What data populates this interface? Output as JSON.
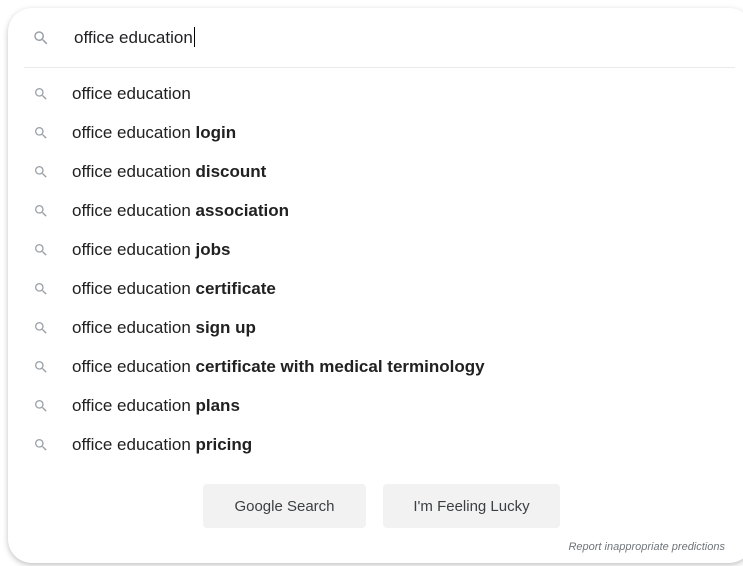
{
  "search": {
    "query": "office education"
  },
  "suggestions": [
    {
      "prefix": "office education",
      "completion": ""
    },
    {
      "prefix": "office education ",
      "completion": "login"
    },
    {
      "prefix": "office education ",
      "completion": "discount"
    },
    {
      "prefix": "office education ",
      "completion": "association"
    },
    {
      "prefix": "office education ",
      "completion": "jobs"
    },
    {
      "prefix": "office education ",
      "completion": "certificate"
    },
    {
      "prefix": "office education ",
      "completion": "sign up"
    },
    {
      "prefix": "office education ",
      "completion": "certificate with medical terminology"
    },
    {
      "prefix": "office education ",
      "completion": "plans"
    },
    {
      "prefix": "office education ",
      "completion": "pricing"
    }
  ],
  "buttons": {
    "google_search": "Google Search",
    "feeling_lucky": "I'm Feeling Lucky"
  },
  "footer": {
    "report_link": "Report inappropriate predictions"
  },
  "icons": {
    "search": "search-icon"
  },
  "colors": {
    "icon": "#9aa0a6",
    "button_bg": "#f2f2f2",
    "text": "#212121",
    "muted": "#70757a"
  }
}
